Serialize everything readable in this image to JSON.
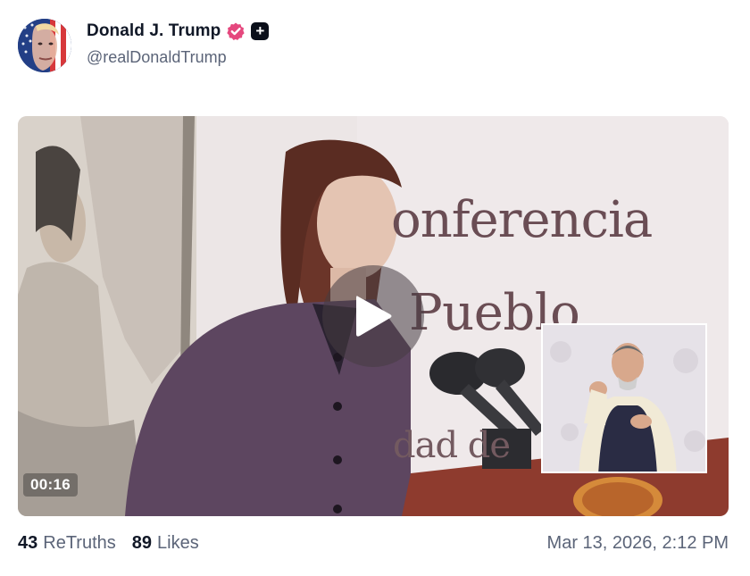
{
  "author": {
    "display_name": "Donald J. Trump",
    "handle": "@realDonaldTrump",
    "avatar_icon": "flag-face-avatar",
    "verified_icon": "verified-badge-icon",
    "verified_color": "#e5487e",
    "plus_icon": "plus-badge-icon",
    "plus_label": "+"
  },
  "media": {
    "type": "video",
    "duration": "00:16",
    "play_icon": "play-icon",
    "banner_lines": [
      "onferencia",
      "Pueblo",
      "dad de"
    ]
  },
  "stats": {
    "retruths_count": "43",
    "retruths_label": "ReTruths",
    "likes_count": "89",
    "likes_label": "Likes"
  },
  "timestamp": "Mar 13, 2026, 2:12 PM",
  "colors": {
    "text_primary": "#111827",
    "text_secondary": "#5b6478",
    "badge_pink": "#e5487e",
    "plus_badge_bg": "#0b0f1a"
  }
}
